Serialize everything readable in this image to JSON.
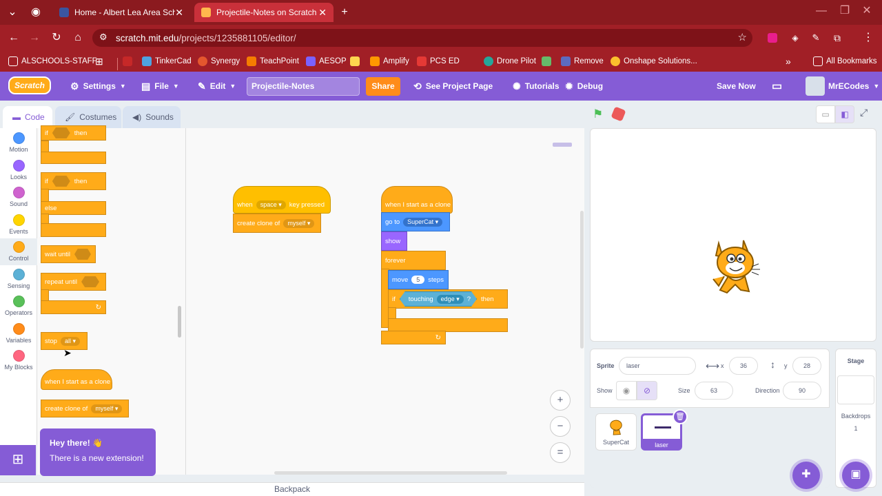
{
  "browser": {
    "tabs": [
      {
        "title": "Home - Albert Lea Area Schools"
      },
      {
        "title": "Projectile-Notes on Scratch"
      }
    ],
    "new_tab": "+",
    "url_host": "scratch.mit.edu",
    "url_path": "/projects/1235881105/editor/",
    "bookmarks": [
      "ALSCHOOLS-STAFF",
      "TinkerCad",
      "Synergy",
      "TeachPoint",
      "AESOP",
      "Amplify",
      "PCS ED",
      "Drone Pilot",
      "Remove",
      "Onshape Solutions..."
    ],
    "all_bookmarks": "All Bookmarks"
  },
  "menubar": {
    "logo": "Scratch",
    "settings": "Settings",
    "file": "File",
    "edit": "Edit",
    "project_title": "Projectile-Notes",
    "share": "Share",
    "see_project_page": "See Project Page",
    "tutorials": "Tutorials",
    "debug": "Debug",
    "save_now": "Save Now",
    "username": "MrECodes"
  },
  "editor_tabs": {
    "code": "Code",
    "costumes": "Costumes",
    "sounds": "Sounds"
  },
  "categories": [
    {
      "label": "Motion",
      "color": "#4c97ff"
    },
    {
      "label": "Looks",
      "color": "#9966ff"
    },
    {
      "label": "Sound",
      "color": "#cf63cf"
    },
    {
      "label": "Events",
      "color": "#ffd500"
    },
    {
      "label": "Control",
      "color": "#ffab19"
    },
    {
      "label": "Sensing",
      "color": "#5cb1d6"
    },
    {
      "label": "Operators",
      "color": "#59c059"
    },
    {
      "label": "Variables",
      "color": "#ff8c1a"
    },
    {
      "label": "My Blocks",
      "color": "#ff6680"
    }
  ],
  "palette": {
    "if_then_if": "if",
    "if_then_then": "then",
    "ifelse_if": "if",
    "ifelse_then": "then",
    "ifelse_else": "else",
    "wait_until": "wait until",
    "repeat_until": "repeat until",
    "stop": "stop",
    "stop_option": "all",
    "clone_hat": "when I start as a clone",
    "create_clone": "create clone of",
    "create_clone_option": "myself"
  },
  "script1": {
    "when": "when",
    "key": "space",
    "key_pressed": "key pressed",
    "create_clone": "create clone of",
    "clone_option": "myself"
  },
  "script2": {
    "hat": "when I start as a clone",
    "go_to": "go to",
    "go_to_option": "SuperCat",
    "show": "show",
    "forever": "forever",
    "move": "move",
    "steps_value": "5",
    "steps": "steps",
    "if": "if",
    "touching": "touching",
    "touching_option": "edge",
    "question": "?",
    "then": "then"
  },
  "zoom": {
    "in": "+",
    "out": "−",
    "reset": "="
  },
  "backpack": "Backpack",
  "sprite_info": {
    "sprite_label": "Sprite",
    "sprite_name": "laser",
    "x_label": "x",
    "x": "36",
    "y_label": "y",
    "y": "28",
    "show_label": "Show",
    "size_label": "Size",
    "size": "63",
    "direction_label": "Direction",
    "direction": "90"
  },
  "sprites": [
    {
      "name": "SuperCat"
    },
    {
      "name": "laser"
    }
  ],
  "stage_panel": {
    "title": "Stage",
    "backdrops_label": "Backdrops",
    "backdrops_count": "1"
  },
  "toast": {
    "title": "Hey there! 👋",
    "message": "There is a new extension!"
  }
}
